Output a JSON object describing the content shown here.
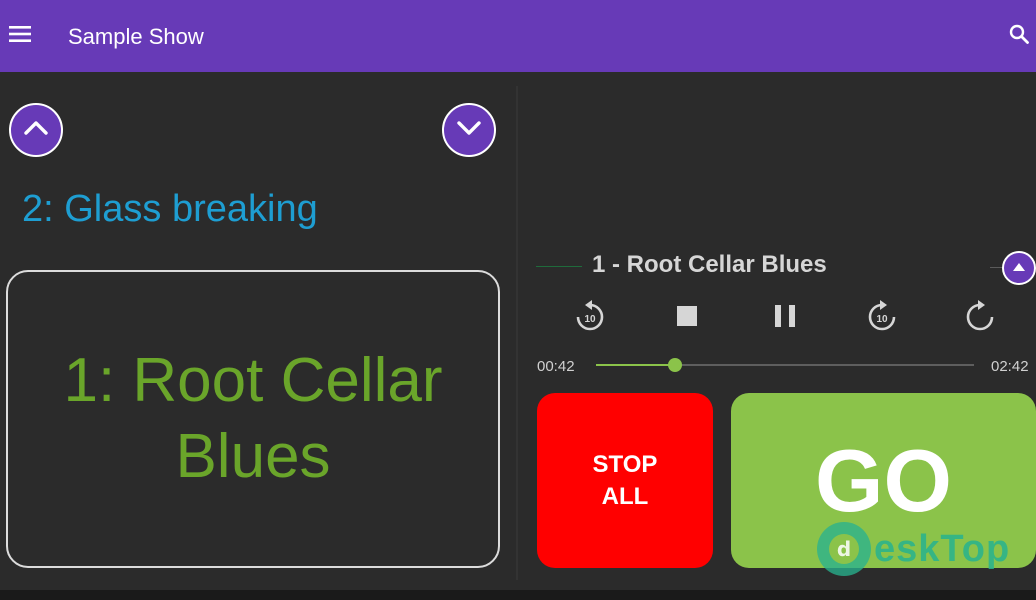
{
  "app": {
    "title": "Sample Show"
  },
  "icons": {
    "menu": "menu-icon",
    "search": "search-icon",
    "up": "chevron-up-icon",
    "down": "chevron-down-icon",
    "replay10": "replay-10-icon",
    "stop": "stop-icon",
    "pause": "pause-icon",
    "forward10": "forward-10-icon",
    "loop": "loop-icon",
    "expand": "triangle-up-icon"
  },
  "cues": {
    "next": "2: Glass breaking",
    "current": "1: Root Cellar Blues"
  },
  "player": {
    "track_title": "1 - Root Cellar Blues",
    "replay_label": "10",
    "forward_label": "10",
    "elapsed": "00:42",
    "total": "02:42",
    "progress": 0.209
  },
  "actions": {
    "stop_all": "STOP ALL",
    "go": "GO"
  },
  "watermark": {
    "text": "eskTop"
  },
  "colors": {
    "appbar": "#673ab7",
    "background": "#2b2b2b",
    "next_cue": "#1e9ed2",
    "current_cue": "#6aa52a",
    "stop": "#ff0000",
    "go": "#8bc34a"
  }
}
